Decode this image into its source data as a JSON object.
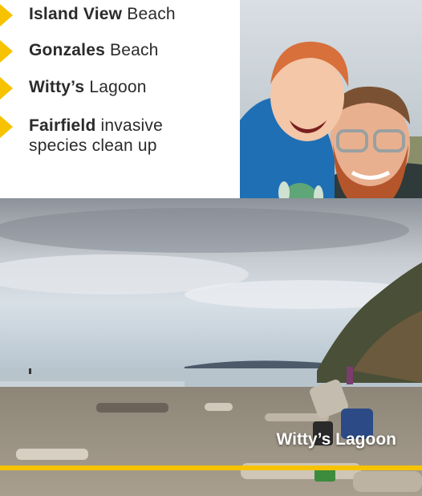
{
  "colors": {
    "accent": "#f7c300",
    "text": "#2b2b2b"
  },
  "list": {
    "items": [
      {
        "bold": "Island View",
        "rest": " Beach"
      },
      {
        "bold": "Gonzales",
        "rest": " Beach"
      },
      {
        "bold": "Witty’s",
        "rest": " Lagoon"
      },
      {
        "bold": "Fairfield",
        "rest": " invasive",
        "line2": "species clean up"
      }
    ]
  },
  "photos": {
    "beach_caption": "Witty’s Lagoon"
  }
}
